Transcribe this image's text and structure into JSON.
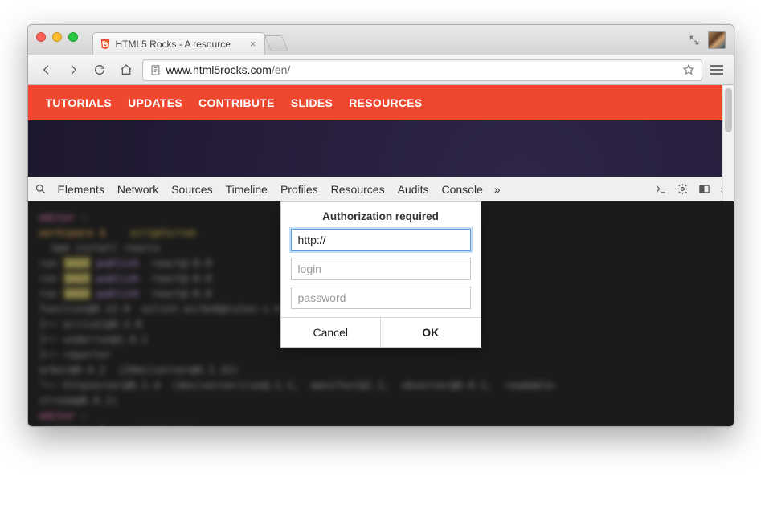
{
  "browser": {
    "tab_title": "HTML5 Rocks - A resource",
    "url_host": "www.html5rocks.com",
    "url_path": "/en/"
  },
  "site_nav": {
    "items": [
      "TUTORIALS",
      "UPDATES",
      "CONTRIBUTE",
      "SLIDES",
      "RESOURCES"
    ]
  },
  "devtools": {
    "tabs": [
      "Elements",
      "Network",
      "Sources",
      "Timeline",
      "Profiles",
      "Resources",
      "Audits",
      "Console"
    ],
    "more_glyph": "»"
  },
  "dialog": {
    "title": "Authorization required",
    "url_value": "http://",
    "login_placeholder": "login",
    "password_placeholder": "password",
    "cancel": "Cancel",
    "ok": "OK"
  }
}
